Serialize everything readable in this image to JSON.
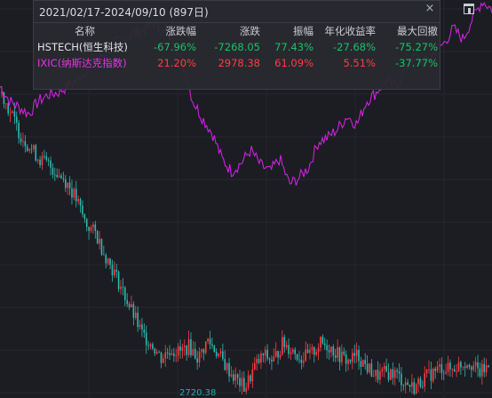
{
  "panel": {
    "date_range": "2021/02/17-2024/09/10 (897日)",
    "close_icon": "×",
    "headers": [
      "名称",
      "涨跌幅",
      "涨跌",
      "振幅",
      "年化收益率",
      "最大回撤"
    ],
    "rows": [
      {
        "name": "HSTECH(恒生科技)",
        "change_pct": "-67.96%",
        "change": "-7268.05",
        "amplitude": "77.43%",
        "annualized": "-27.68%",
        "max_drawdown": "-75.27%"
      },
      {
        "name": "IXIC(纳斯达克指数)",
        "change_pct": "21.20%",
        "change": "2978.38",
        "amplitude": "61.09%",
        "annualized": "5.51%",
        "max_drawdown": "-37.77%"
      }
    ]
  },
  "corner_icon": "expand-icon",
  "min_label": "2720.38",
  "colors": {
    "background": "#1b1d22",
    "ixic_line": "#cc22dd",
    "candle_up": "#ff3b44",
    "candle_down": "#2fb7b2",
    "positive": "#ff3b44",
    "negative": "#19c16a"
  },
  "chart_data": {
    "type": "line",
    "title": "",
    "series": [
      {
        "name": "IXIC(纳斯达克指数)",
        "style": "line",
        "relative_values": [
          0.7,
          0.63,
          0.6,
          0.57,
          0.63,
          0.66,
          0.67,
          0.7,
          0.73,
          0.78,
          0.82,
          0.86,
          0.9,
          0.93,
          0.95,
          0.97,
          1.0,
          0.95,
          0.92,
          0.8,
          0.63,
          0.55,
          0.48,
          0.36,
          0.3,
          0.34,
          0.4,
          0.33,
          0.3,
          0.36,
          0.24,
          0.27,
          0.32,
          0.44,
          0.46,
          0.5,
          0.56,
          0.52,
          0.63,
          0.67,
          0.73,
          0.7,
          0.78,
          0.84,
          0.81,
          0.86,
          0.9,
          0.97,
          0.92,
          1.02,
          1.1,
          1.06
        ]
      },
      {
        "name": "HSTECH(恒生科技)",
        "style": "candlestick",
        "relative_values": [
          1.0,
          0.93,
          0.86,
          0.82,
          0.78,
          0.76,
          0.73,
          0.7,
          0.64,
          0.56,
          0.53,
          0.46,
          0.4,
          0.33,
          0.26,
          0.19,
          0.16,
          0.11,
          0.14,
          0.13,
          0.15,
          0.11,
          0.17,
          0.13,
          0.08,
          0.04,
          0.01,
          0.08,
          0.12,
          0.1,
          0.16,
          0.14,
          0.11,
          0.12,
          0.16,
          0.15,
          0.12,
          0.1,
          0.12,
          0.08,
          0.05,
          0.06,
          0.06,
          0.03,
          0.01,
          0.04,
          0.06,
          0.08,
          0.07,
          0.09,
          0.1,
          0.06,
          0.08
        ]
      }
    ],
    "x_range": [
      "2021/02/17",
      "2024/09/10"
    ],
    "annotations": [
      "2720.38"
    ]
  }
}
